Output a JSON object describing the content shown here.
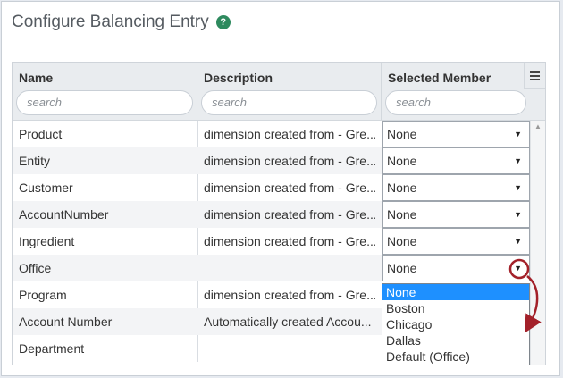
{
  "dialog": {
    "title": "Configure Balancing Entry",
    "help_glyph": "?"
  },
  "grid": {
    "columns": [
      {
        "label": "Name",
        "search_placeholder": "search"
      },
      {
        "label": "Description",
        "search_placeholder": "search"
      },
      {
        "label": "Selected Member",
        "search_placeholder": "search"
      }
    ],
    "rows": [
      {
        "name": "Product",
        "description": "dimension created from - Gre...",
        "member": "None"
      },
      {
        "name": "Entity",
        "description": "dimension created from - Gre...",
        "member": "None"
      },
      {
        "name": "Customer",
        "description": "dimension created from - Gre...",
        "member": "None"
      },
      {
        "name": "AccountNumber",
        "description": "dimension created from - Gre...",
        "member": "None"
      },
      {
        "name": "Ingredient",
        "description": "dimension created from - Gre...",
        "member": "None"
      },
      {
        "name": "Office",
        "description": "",
        "member": "None"
      },
      {
        "name": "Program",
        "description": "dimension created from - Gre...",
        "member": ""
      },
      {
        "name": "Account Number",
        "description": "Automatically created Accou...",
        "member": ""
      },
      {
        "name": "Department",
        "description": "",
        "member": ""
      }
    ],
    "open_dropdown": {
      "row": "Office",
      "options": [
        "None",
        "Boston",
        "Chicago",
        "Dallas",
        "Default (Office)"
      ],
      "selected": "None"
    }
  },
  "colors": {
    "accent_green": "#2e8a5e",
    "selection_blue": "#1e90ff",
    "annotation_red": "#a3212a"
  },
  "icons": {
    "help": "help-icon",
    "column_menu": "hamburger-menu-icon",
    "dropdown_arrow": "caret-down-icon",
    "scroll_up": "scroll-up-icon"
  }
}
